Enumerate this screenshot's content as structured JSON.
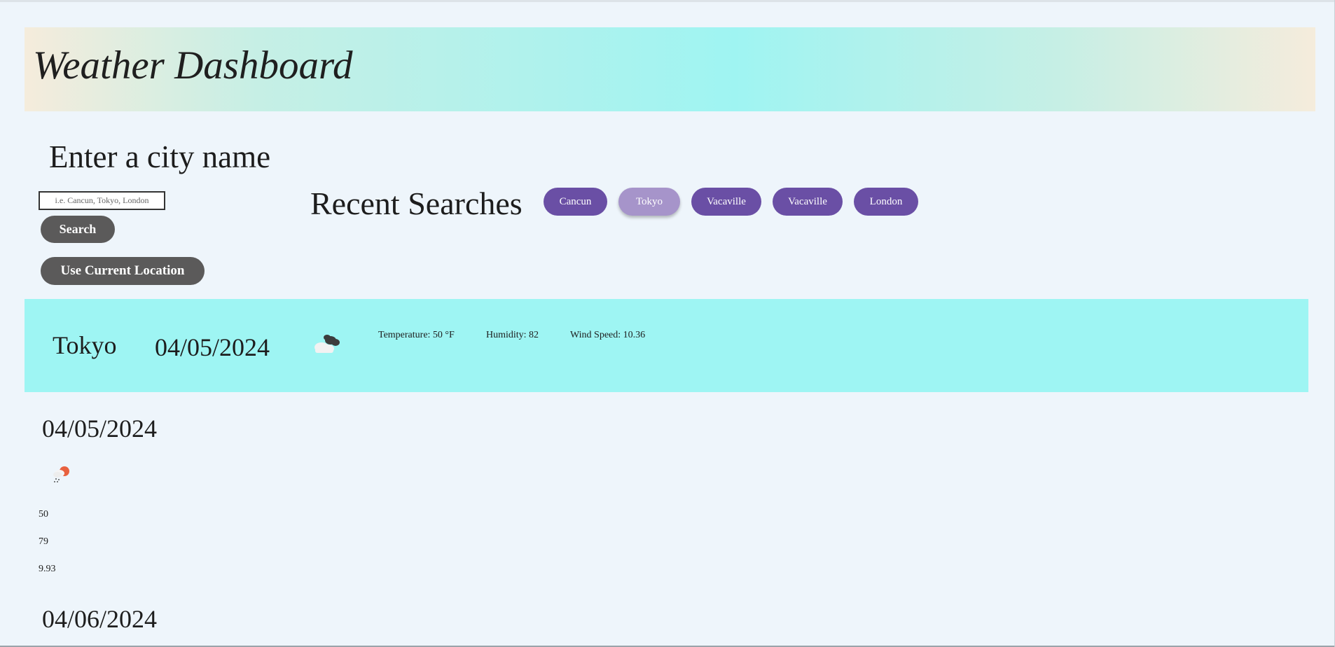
{
  "header": {
    "title": "Weather Dashboard"
  },
  "search": {
    "label": "Enter a city name",
    "placeholder": "i.e. Cancun, Tokyo, London",
    "search_button": "Search",
    "location_button": "Use Current Location"
  },
  "recent": {
    "label": "Recent Searches",
    "items": [
      {
        "label": "Cancun",
        "active": false
      },
      {
        "label": "Tokyo",
        "active": true
      },
      {
        "label": "Vacaville",
        "active": false
      },
      {
        "label": "Vacaville",
        "active": false
      },
      {
        "label": "London",
        "active": false
      }
    ]
  },
  "current": {
    "city": "Tokyo",
    "date": "04/05/2024",
    "icon": "broken-clouds-icon",
    "temperature": "Temperature: 50 °F",
    "humidity": "Humidity: 82",
    "wind": "Wind Speed: 10.36"
  },
  "forecast": [
    {
      "date": "04/05/2024",
      "icon": "sun-rain-icon",
      "temp": "50",
      "humidity": "79",
      "wind": "9.93"
    },
    {
      "date": "04/06/2024"
    }
  ],
  "colors": {
    "background": "#eef5fb",
    "current_bg": "#9ef5f3",
    "chip": "#6a4fa5",
    "chip_active": "#a694ca",
    "button": "#5b5a5a"
  }
}
